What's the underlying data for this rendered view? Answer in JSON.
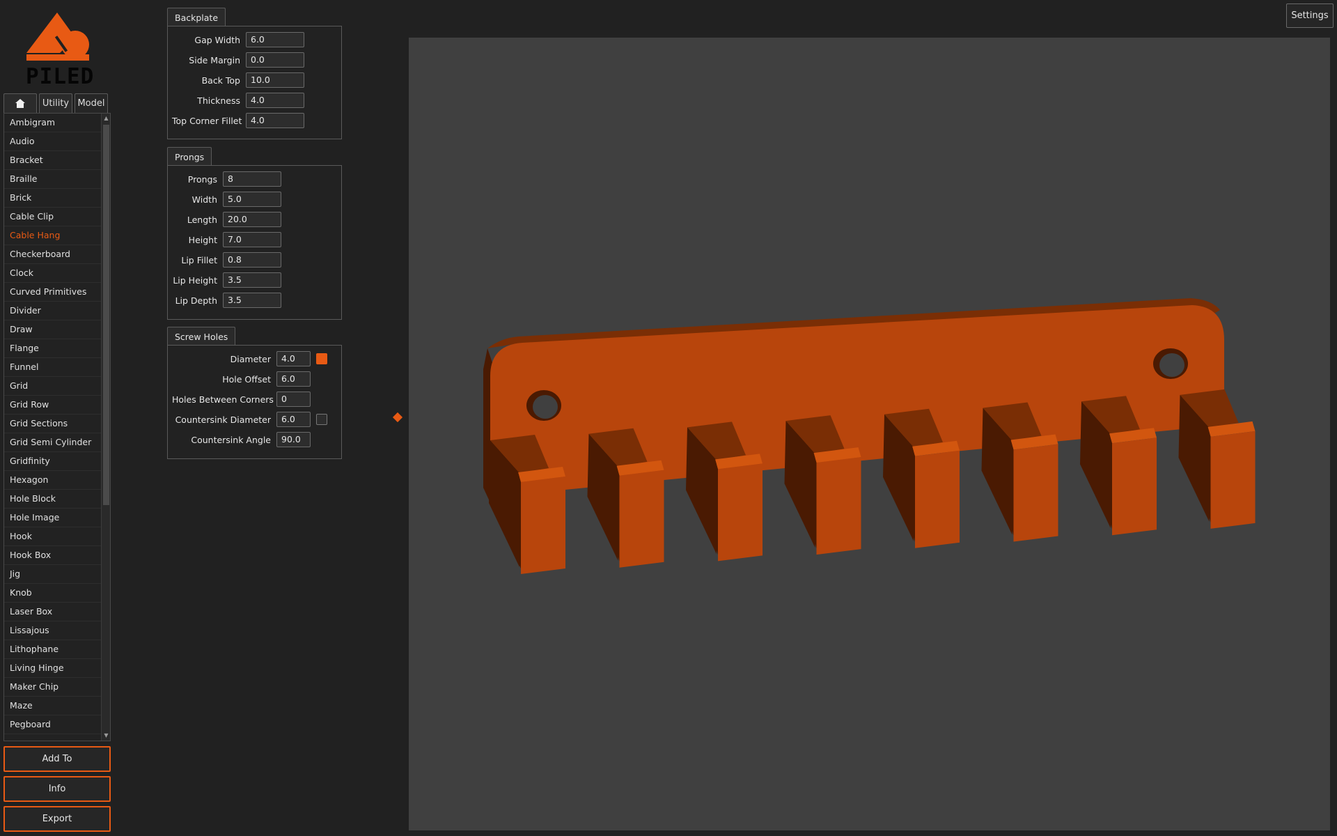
{
  "app": {
    "logo_text": "PILED",
    "accent_color": "#e85a14"
  },
  "tabs": [
    {
      "icon": "home-icon"
    },
    {
      "label": "Utility"
    },
    {
      "label": "Model"
    }
  ],
  "models": {
    "selected": "Cable Hang",
    "items": [
      "Ambigram",
      "Audio",
      "Bracket",
      "Braille",
      "Brick",
      "Cable Clip",
      "Cable Hang",
      "Checkerboard",
      "Clock",
      "Curved Primitives",
      "Divider",
      "Draw",
      "Flange",
      "Funnel",
      "Grid",
      "Grid Row",
      "Grid Sections",
      "Grid Semi Cylinder",
      "Gridfinity",
      "Hexagon",
      "Hole Block",
      "Hole Image",
      "Hook",
      "Hook Box",
      "Jig",
      "Knob",
      "Laser Box",
      "Lissajous",
      "Lithophane",
      "Living Hinge",
      "Maker Chip",
      "Maze",
      "Pegboard"
    ]
  },
  "actions": {
    "add_to": "Add To",
    "info": "Info",
    "export": "Export"
  },
  "settings_label": "Settings",
  "groups": {
    "backplate": {
      "title": "Backplate",
      "rows": [
        {
          "label": "Gap Width",
          "value": "6.0"
        },
        {
          "label": "Side Margin",
          "value": "0.0"
        },
        {
          "label": "Back Top",
          "value": "10.0"
        },
        {
          "label": "Thickness",
          "value": "4.0"
        },
        {
          "label": "Top Corner Fillet",
          "value": "4.0"
        }
      ]
    },
    "prongs": {
      "title": "Prongs",
      "rows": [
        {
          "label": "Prongs",
          "value": "8"
        },
        {
          "label": "Width",
          "value": "5.0"
        },
        {
          "label": "Length",
          "value": "20.0"
        },
        {
          "label": "Height",
          "value": "7.0"
        },
        {
          "label": "Lip Fillet",
          "value": "0.8"
        },
        {
          "label": "Lip Height",
          "value": "3.5"
        },
        {
          "label": "Lip Depth",
          "value": "3.5"
        }
      ]
    },
    "screw_holes": {
      "title": "Screw Holes",
      "rows": [
        {
          "label": "Diameter",
          "value": "4.0",
          "toggle": true
        },
        {
          "label": "Hole Offset",
          "value": "6.0"
        },
        {
          "label": "Holes Between Corners",
          "value": "0"
        },
        {
          "label": "Countersink Diameter",
          "value": "6.0",
          "toggle": false
        },
        {
          "label": "Countersink Angle",
          "value": "90.0"
        }
      ]
    }
  },
  "model_colors": {
    "front": "#b8450c",
    "top": "#c9510f",
    "side_dark": "#4a1a02",
    "side_mid": "#7a2e05",
    "top_light": "#d2560f"
  }
}
